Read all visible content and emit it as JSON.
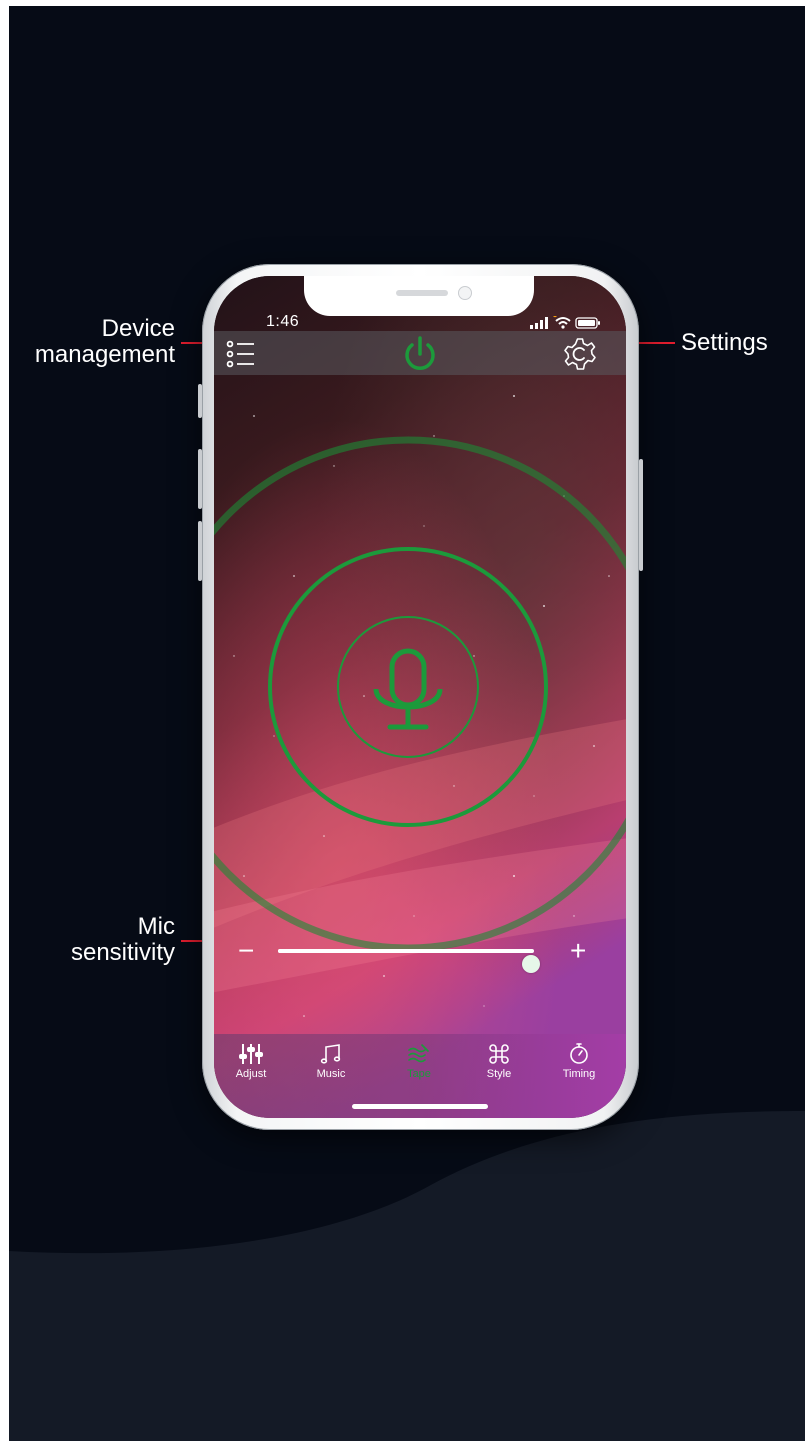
{
  "callouts": {
    "device_management": [
      "Device",
      "management"
    ],
    "settings": "Settings",
    "mic_sensitivity": [
      "Mic",
      "sensitivity"
    ]
  },
  "status_bar": {
    "time": "1:46"
  },
  "top_bar": {
    "left_icon": "device-list-icon",
    "center_icon": "power-icon",
    "right_icon": "gear-icon"
  },
  "mic": {
    "icon": "microphone-icon"
  },
  "mic_sensitivity_slider": {
    "value": 0.99,
    "minus_label": "−",
    "plus_label": "+"
  },
  "bottom_nav": {
    "items": [
      {
        "label": "Adjust",
        "icon": "equalizer-icon",
        "active": false
      },
      {
        "label": "Music",
        "icon": "music-note-icon",
        "active": false
      },
      {
        "label": "Tape",
        "icon": "tape-icon",
        "active": true
      },
      {
        "label": "Style",
        "icon": "command-icon",
        "active": false
      },
      {
        "label": "Timing",
        "icon": "timer-icon",
        "active": false
      }
    ]
  },
  "colors": {
    "accent_green": "#1c9a3b",
    "callout_red": "#e21d2e",
    "background": "#060b16"
  }
}
